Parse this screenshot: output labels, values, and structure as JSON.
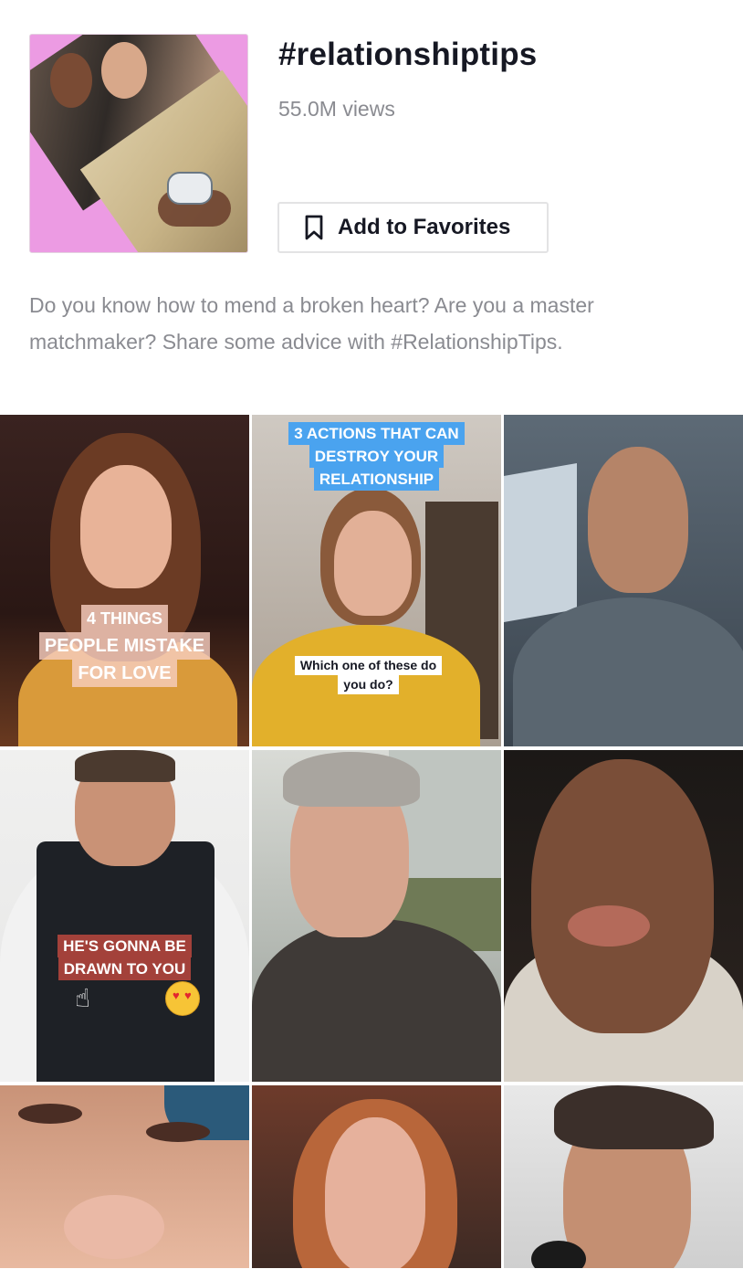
{
  "hashtag": {
    "title": "#relationshiptips",
    "views": "55.0M views",
    "favorite_label": "Add to Favorites",
    "description": "Do you know how to mend a broken heart? Are you a master matchmaker? Share some advice with #RelationshipTips."
  },
  "icons": {
    "favorite": "bookmark-icon"
  },
  "videos": [
    {
      "caption_lines": [
        "4 THINGS",
        "PEOPLE MISTAKE",
        "FOR LOVE"
      ]
    },
    {
      "caption_top_lines": [
        "3 ACTIONS THAT CAN",
        "DESTROY YOUR",
        "RELATIONSHIP"
      ],
      "caption_bottom_lines": [
        "Which one of these do",
        "you do?"
      ]
    },
    {},
    {
      "caption_lines": [
        "HE'S GONNA BE",
        "DRAWN TO YOU"
      ]
    },
    {},
    {},
    {},
    {},
    {}
  ],
  "colors": {
    "text_primary": "#161823",
    "text_secondary": "#8a8b91",
    "border": "#e3e3e4",
    "caption_blue": "#4aa3ef",
    "caption_red": "#a3413a"
  }
}
